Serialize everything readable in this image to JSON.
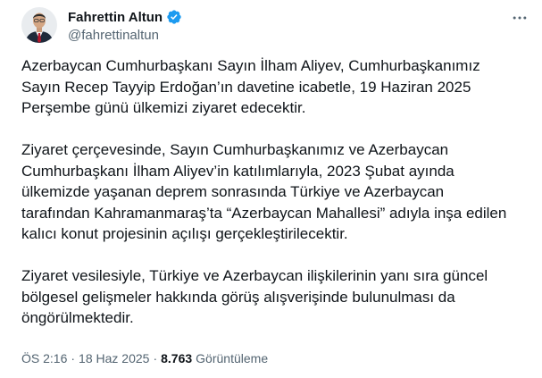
{
  "author": {
    "display_name": "Fahrettin Altun",
    "handle": "@fahrettinaltun",
    "verified": true
  },
  "tweet": {
    "paragraphs": [
      "Azerbaycan Cumhurbaşkanı Sayın İlham Aliyev, Cumhurbaşkanımız\nSayın Recep Tayyip Erdoğan’ın davetine icabetle, 19 Haziran 2025\nPerşembe günü ülkemizi ziyaret edecektir.",
      "Ziyaret çerçevesinde, Sayın Cumhurbaşkanımız ve Azerbaycan\nCumhurbaşkanı İlham Aliyev’in katılımlarıyla, 2023 Şubat ayında\nülkemizde yaşanan deprem sonrasında Türkiye ve Azerbaycan\ntarafından Kahramanmaraş’ta “Azerbaycan Mahallesi” adıyla inşa edilen\nkalıcı konut projesinin açılışı gerçekleştirilecektir.",
      "Ziyaret vesilesiyle, Türkiye ve Azerbaycan ilişkilerinin yanı sıra güncel\nbölgesel gelişmeler hakkında görüş alışverişinde bulunulması da\nöngörülmektedir."
    ]
  },
  "meta": {
    "time": "ÖS 2:16",
    "separator": "·",
    "date": "18 Haz 2025",
    "views_count": "8.763",
    "views_label": "Görüntüleme"
  },
  "icons": {
    "verified": "verified-badge-icon",
    "more": "more-options-icon"
  },
  "colors": {
    "verified_badge": "#1d9bf0",
    "text_primary": "#0f1419",
    "text_secondary": "#536471"
  }
}
